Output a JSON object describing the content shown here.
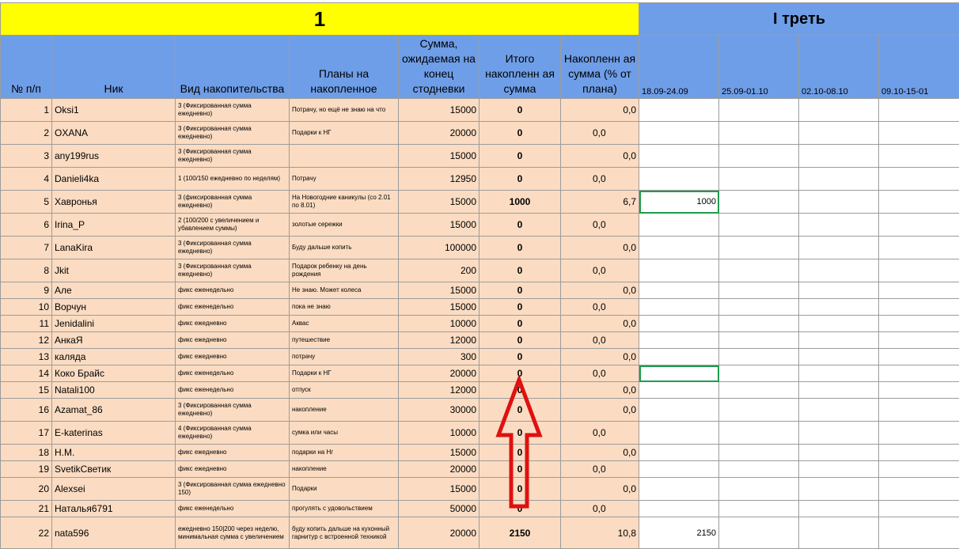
{
  "sheet": {
    "title_block": "1",
    "period_title": "I треть",
    "headers": {
      "num": "№ п/п",
      "nick": "Ник",
      "type": "Вид накопительства",
      "plans": "Планы на накопленное",
      "expected": "Сумма, ожидаемая на конец стодневки",
      "total": "Итого накопленн ая сумма",
      "percent": "Накопленн ая сумма (% от плана)",
      "weeks": [
        "18.09-24.09",
        "25.09-01.10",
        "02.10-08.10",
        "09.10-15-01"
      ]
    },
    "rows": [
      {
        "n": "1",
        "nick": "Oksi1",
        "type": "3 (Фиксированная сумма ежедневно)",
        "plan": "Потрачу, но ещё не знаю на что",
        "sum": "15000",
        "total": "0",
        "pct": "0,0",
        "align": "r",
        "w1": ""
      },
      {
        "n": "2",
        "nick": "OXANA",
        "type": "3 (Фиксированная сумма ежедневно)",
        "plan": "Подарки к НГ",
        "sum": "20000",
        "total": "0",
        "pct": "0,0",
        "align": "m",
        "w1": ""
      },
      {
        "n": "3",
        "nick": "any199rus",
        "type": "3 (Фиксированная сумма ежедневно)",
        "plan": "",
        "sum": "15000",
        "total": "0",
        "pct": "0,0",
        "align": "r",
        "w1": ""
      },
      {
        "n": "4",
        "nick": "Danieli4ka",
        "type": "1 (100/150 ежедневно по неделям)",
        "plan": "Потрачу",
        "sum": "12950",
        "total": "0",
        "pct": "0,0",
        "align": "m",
        "w1": ""
      },
      {
        "n": "5",
        "nick": "Хавронья",
        "type": "3 (фиксированная сумма ежедневно)",
        "plan": "На Новогодние каникулы (со 2.01 по 8.01)",
        "sum": "15000",
        "total": "1000",
        "pct": "6,7",
        "align": "r",
        "w1": "1000"
      },
      {
        "n": "6",
        "nick": "Irina_P",
        "type": "2 (100/200 с увеличением и убавлением суммы)",
        "plan": "золотые сережки",
        "sum": "15000",
        "total": "0",
        "pct": "0,0",
        "align": "m",
        "w1": ""
      },
      {
        "n": "7",
        "nick": "LanaKira",
        "type": "3 (Фиксированная сумма ежедневно)",
        "plan": "Буду дальше копить",
        "sum": "100000",
        "total": "0",
        "pct": "0,0",
        "align": "r",
        "w1": ""
      },
      {
        "n": "8",
        "nick": "Jkit",
        "type": "3 (Фиксированная сумма ежедневно)",
        "plan": "Подарок ребенку на день рождения",
        "sum": "200",
        "total": "0",
        "pct": "0,0",
        "align": "m",
        "w1": ""
      },
      {
        "n": "9",
        "nick": "Але",
        "type": "фикс еженедельно",
        "plan": "Не знаю. Может колеса",
        "sum": "15000",
        "total": "0",
        "pct": "0,0",
        "align": "r",
        "w1": ""
      },
      {
        "n": "10",
        "nick": "Ворчун",
        "type": "фикс еженедельно",
        "plan": "пока не знаю",
        "sum": "15000",
        "total": "0",
        "pct": "0,0",
        "align": "m",
        "w1": ""
      },
      {
        "n": "11",
        "nick": "Jenidalini",
        "type": "фикс ежедневно",
        "plan": "Аквас",
        "sum": "10000",
        "total": "0",
        "pct": "0,0",
        "align": "r",
        "w1": ""
      },
      {
        "n": "12",
        "nick": "АнкаЯ",
        "type": "фикс ежедневно",
        "plan": "путешествие",
        "sum": "12000",
        "total": "0",
        "pct": "0,0",
        "align": "m",
        "w1": ""
      },
      {
        "n": "13",
        "nick": "каляда",
        "type": "фикс ежедневно",
        "plan": "потрачу",
        "sum": "300",
        "total": "0",
        "pct": "0,0",
        "align": "r",
        "w1": ""
      },
      {
        "n": "14",
        "nick": "Коко Брайс",
        "type": "фикс еженедельно",
        "plan": "Подарки к НГ",
        "sum": "20000",
        "total": "0",
        "pct": "0,0",
        "align": "m",
        "w1": ""
      },
      {
        "n": "15",
        "nick": "Natali100",
        "type": "фикс еженедельно",
        "plan": "отпуск",
        "sum": "12000",
        "total": "0",
        "pct": "0,0",
        "align": "r",
        "w1": ""
      },
      {
        "n": "16",
        "nick": "Azamat_86",
        "type": "3 (Фиксированная сумма ежедневно)",
        "plan": "накопление",
        "sum": "30000",
        "total": "0",
        "pct": "0,0",
        "align": "r",
        "w1": ""
      },
      {
        "n": "17",
        "nick": "E-katerinas",
        "type": "4 (Фиксированная сумма ежедневно)",
        "plan": "сумка или часы",
        "sum": "10000",
        "total": "0",
        "pct": "0,0",
        "align": "m",
        "w1": ""
      },
      {
        "n": "18",
        "nick": "Н.М.",
        "type": "фикс ежедневно",
        "plan": "подарки на Нг",
        "sum": "15000",
        "total": "0",
        "pct": "0,0",
        "align": "r",
        "w1": ""
      },
      {
        "n": "19",
        "nick": "SvetikСветик",
        "type": "фикс ежедневно",
        "plan": "накопление",
        "sum": "20000",
        "total": "0",
        "pct": "0,0",
        "align": "m",
        "w1": ""
      },
      {
        "n": "20",
        "nick": "Alexsei",
        "type": "3 (Фиксированная сумма ежедневно 150)",
        "plan": "Подарки",
        "sum": "15000",
        "total": "0",
        "pct": "0,0",
        "align": "r",
        "w1": ""
      },
      {
        "n": "21",
        "nick": "Наталья6791",
        "type": "фикс еженедельно",
        "plan": "прогулять с удовольствием",
        "sum": "50000",
        "total": "0",
        "pct": "0,0",
        "align": "m",
        "w1": ""
      },
      {
        "n": "22",
        "nick": "nata596",
        "type": "ежедневно 150|200 через неделю, минимальная сумма с увеличением",
        "plan": "буду копить дальше на кухонный гарнитур с встроенной техникой",
        "sum": "20000",
        "total": "2150",
        "pct": "10,8",
        "align": "r",
        "w1": "2150"
      }
    ]
  },
  "annotation": {
    "arrow_color": "#e01010"
  }
}
